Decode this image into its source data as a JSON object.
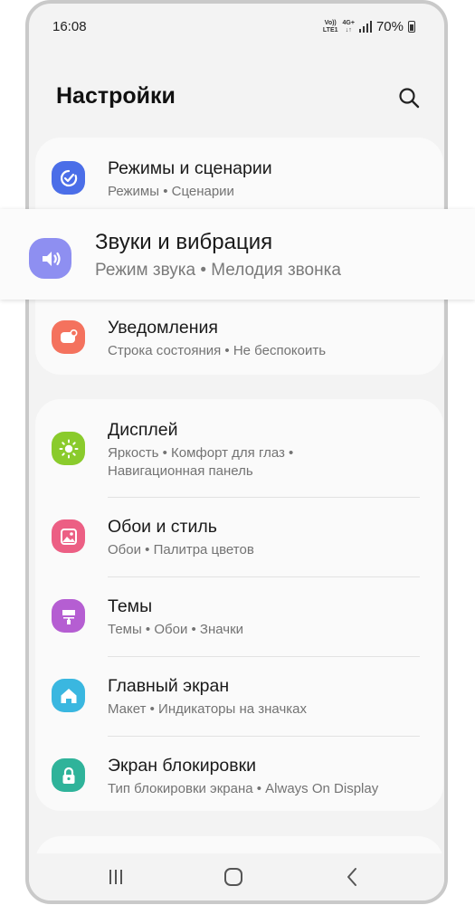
{
  "status_bar": {
    "time": "16:08",
    "network_top": "Vo))",
    "network_bottom": "LTE1",
    "net_type": "4G+",
    "battery_percent": "70%"
  },
  "header": {
    "title": "Настройки",
    "search_icon": "search-icon"
  },
  "group1": {
    "items": [
      {
        "title": "Режимы и сценарии",
        "subtitle": "Режимы • Сценарии",
        "icon": "modes-icon",
        "color": "#4b6ee8"
      },
      {
        "title": "Уведомления",
        "subtitle": "Строка состояния • Не беспокоить",
        "icon": "notifications-icon",
        "color": "#f4725e"
      }
    ]
  },
  "highlighted": {
    "title": "Звуки и вибрация",
    "subtitle": "Режим звука • Мелодия звонка",
    "icon": "volume-icon",
    "color": "#8e8ff1"
  },
  "group2": {
    "items": [
      {
        "title": "Дисплей",
        "subtitle_line1": "Яркость • Комфорт для глаз •",
        "subtitle_line2": "Навигационная панель",
        "icon": "brightness-icon",
        "color": "#8acb2c"
      },
      {
        "title": "Обои и стиль",
        "subtitle": "Обои • Палитра цветов",
        "icon": "wallpaper-icon",
        "color": "#ec5f84"
      },
      {
        "title": "Темы",
        "subtitle": "Темы • Обои • Значки",
        "icon": "themes-icon",
        "color": "#b55ed2"
      },
      {
        "title": "Главный экран",
        "subtitle": "Макет • Индикаторы на значках",
        "icon": "home-icon",
        "color": "#3ab7e0"
      },
      {
        "title": "Экран блокировки",
        "subtitle": "Тип блокировки экрана • Always On Display",
        "icon": "lock-icon",
        "color": "#2fb39a"
      }
    ]
  },
  "nav_bar": {
    "recent_icon": "recent-apps-icon",
    "home_icon": "home-button-icon",
    "back_icon": "back-icon"
  }
}
